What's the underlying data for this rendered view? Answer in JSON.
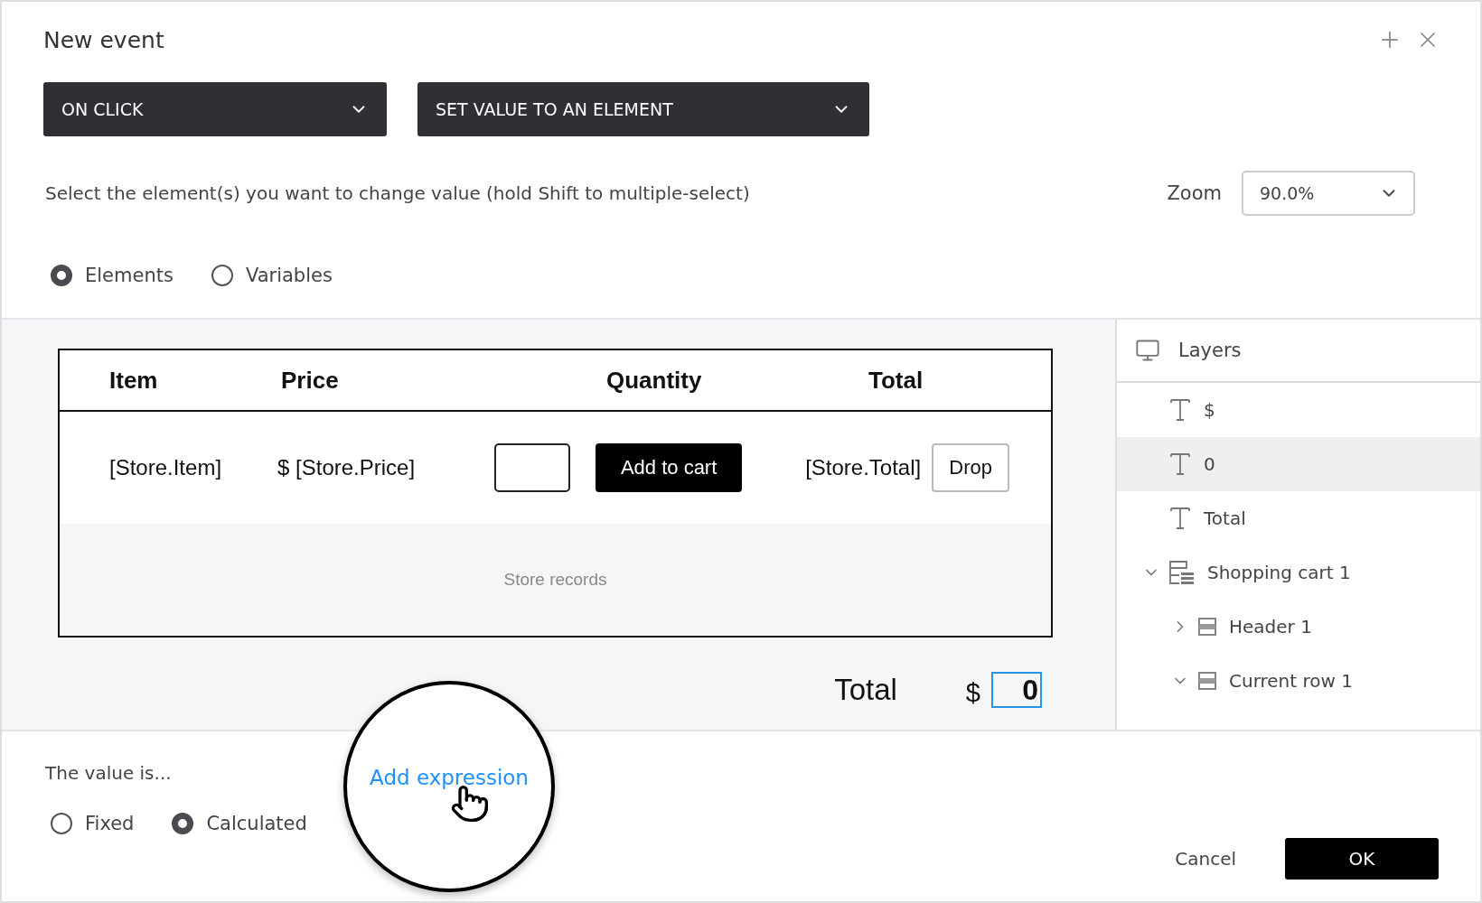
{
  "dialog": {
    "title": "New event"
  },
  "trigger_dropdown": {
    "value": "ON CLICK"
  },
  "action_dropdown": {
    "value": "SET VALUE TO AN ELEMENT"
  },
  "instruction": "Select the element(s) you want to change value (hold Shift to multiple-select)",
  "zoom": {
    "label": "Zoom",
    "value": "90.0%"
  },
  "target_options": [
    {
      "label": "Elements",
      "selected": true
    },
    {
      "label": "Variables",
      "selected": false
    }
  ],
  "canvas": {
    "table": {
      "columns": [
        "Item",
        "Price",
        "Quantity",
        "Total"
      ],
      "row": {
        "item": "[Store.Item]",
        "price_symbol": "$",
        "price": "[Store.Price]",
        "add_button": "Add to cart",
        "total": "[Store.Total]",
        "drop_button": "Drop"
      },
      "records_label": "Store records"
    },
    "total_label": "Total",
    "total_currency": "$",
    "total_value": "0"
  },
  "layers": {
    "title": "Layers",
    "items": [
      {
        "kind": "text",
        "label": "$",
        "selected": false
      },
      {
        "kind": "text",
        "label": "0",
        "selected": true
      },
      {
        "kind": "text",
        "label": "Total",
        "selected": false
      },
      {
        "kind": "list",
        "label": "Shopping cart 1",
        "selected": false,
        "expanded": true,
        "children": [
          {
            "kind": "row",
            "label": "Header 1",
            "selected": false,
            "expanded": false
          },
          {
            "kind": "row",
            "label": "Current row 1",
            "selected": false,
            "expanded": true
          }
        ]
      }
    ]
  },
  "value_section": {
    "label": "The value is...",
    "options": [
      {
        "label": "Fixed",
        "selected": false
      },
      {
        "label": "Calculated",
        "selected": true
      }
    ],
    "link": "Add expression"
  },
  "buttons": {
    "cancel": "Cancel",
    "ok": "OK"
  }
}
